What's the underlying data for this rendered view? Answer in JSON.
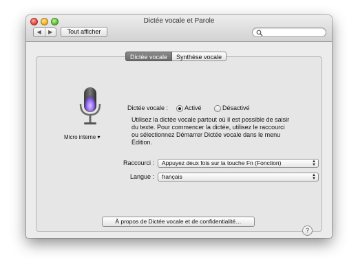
{
  "window": {
    "title": "Dictée vocale et Parole"
  },
  "toolbar": {
    "back_icon": "chevron-left-icon",
    "forward_icon": "chevron-right-icon",
    "back_glyph": "◀",
    "forward_glyph": "▶",
    "show_all_label": "Tout afficher",
    "search_placeholder": ""
  },
  "tabs": [
    {
      "label": "Dictée vocale",
      "selected": true
    },
    {
      "label": "Synthèse vocale",
      "selected": false
    }
  ],
  "microphone": {
    "icon": "microphone-icon",
    "label": "Micro interne ▾"
  },
  "dictation": {
    "label": "Dictée vocale :",
    "options": [
      {
        "label": "Activé",
        "selected": true
      },
      {
        "label": "Désactivé",
        "selected": false
      }
    ],
    "description": [
      "Utilisez la dictée vocale partout où il est possible de saisir",
      "du texte. Pour commencer la dictée, utilisez le raccourci",
      "ou sélectionnez Démarrer Dictée vocale dans le menu",
      "Édition."
    ]
  },
  "shortcut": {
    "label": "Raccourci :",
    "value": "Appuyez deux fois sur la touche Fn (Fonction)"
  },
  "language": {
    "label": "Langue :",
    "value": "français"
  },
  "about_button": "À propos de Dictée vocale et de confidentialité…",
  "help_button": "?",
  "colors": {
    "accent_mic": "#8a5cf0",
    "traffic_close": "#e0463a",
    "traffic_minimize": "#f0b023",
    "traffic_maximize": "#5fbf3a"
  }
}
